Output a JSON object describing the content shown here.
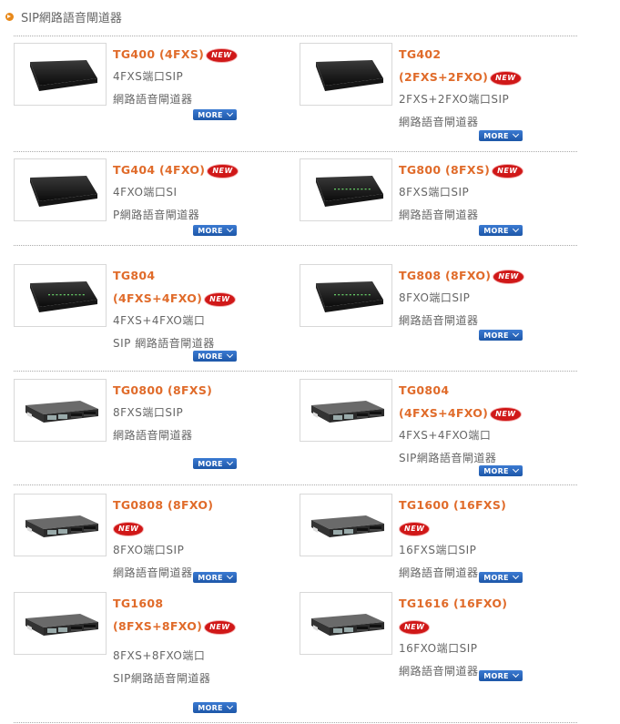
{
  "header": {
    "title": "SIP網路語音閘道器"
  },
  "products": [
    {
      "id": "tg400",
      "title_lines": [
        "TG400 (4FXS)"
      ],
      "new_on_line": 0,
      "desc_lines": [
        "4FXS端口SIP",
        "網路語音閘道器"
      ],
      "device": "router"
    },
    {
      "id": "tg402",
      "title_lines": [
        "TG402",
        "(2FXS+2FXO)"
      ],
      "new_on_line": 1,
      "desc_lines": [
        "2FXS+2FXO端口SIP",
        "網路語音閘道器"
      ],
      "device": "router"
    },
    {
      "id": "tg404",
      "title_lines": [
        "TG404 (4FXO)"
      ],
      "new_on_line": 0,
      "desc_lines": [
        "4FXO端口SI",
        "P網路語音閘道器"
      ],
      "device": "router"
    },
    {
      "id": "tg800",
      "title_lines": [
        "TG800 (8FXS)"
      ],
      "new_on_line": 0,
      "desc_lines": [
        "8FXS端口SIP",
        "網路語音閘道器"
      ],
      "device": "router-lights"
    },
    {
      "id": "tg804",
      "title_lines": [
        "TG804",
        "(4FXS+4FXO)"
      ],
      "new_on_line": 1,
      "desc_lines": [
        "4FXS+4FXO端口",
        "SIP 網路語音閘道器"
      ],
      "device": "router-lights"
    },
    {
      "id": "tg808",
      "title_lines": [
        "TG808 (8FXO)"
      ],
      "new_on_line": 0,
      "desc_lines": [
        "8FXO端口SIP",
        "網路語音閘道器"
      ],
      "device": "router-lights"
    },
    {
      "id": "tg0800",
      "title_lines": [
        "TG0800 (8FXS)"
      ],
      "new_on_line": -1,
      "desc_lines": [
        "8FXS端口SIP",
        "網路語音閘道器"
      ],
      "device": "rack"
    },
    {
      "id": "tg0804",
      "title_lines": [
        "TG0804",
        "(4FXS+4FXO)"
      ],
      "new_on_line": 1,
      "desc_lines": [
        "4FXS+4FXO端口",
        "SIP網路語音閘道器"
      ],
      "device": "rack"
    },
    {
      "id": "tg0808",
      "title_lines": [
        "TG0808 (8FXO)"
      ],
      "new_on_line": "below",
      "desc_lines": [
        "8FXO端口SIP",
        "網路語音閘道器"
      ],
      "device": "rack"
    },
    {
      "id": "tg1600",
      "title_lines": [
        "TG1600 (16FXS)"
      ],
      "new_on_line": "below",
      "desc_lines": [
        "16FXS端口SIP",
        "網路語音閘道器"
      ],
      "device": "rack"
    },
    {
      "id": "tg1608",
      "title_lines": [
        "TG1608",
        "(8FXS+8FXO)"
      ],
      "new_on_line": 1,
      "desc_lines": [
        "8FXS+8FXO端口",
        "SIP網路語音閘道器"
      ],
      "device": "rack"
    },
    {
      "id": "tg1616",
      "title_lines": [
        "TG1616 (16FXO)"
      ],
      "new_on_line": "below",
      "desc_lines": [
        "16FXO端口SIP",
        "網路語音閘道器"
      ],
      "device": "rack"
    }
  ],
  "badges": {
    "new_label": "NEW",
    "more_label": "MORE"
  },
  "colors": {
    "title": "#e06b2a",
    "new_badge": "#d01818",
    "more_button": "#1d57a8",
    "bullet": "#e8891a"
  }
}
